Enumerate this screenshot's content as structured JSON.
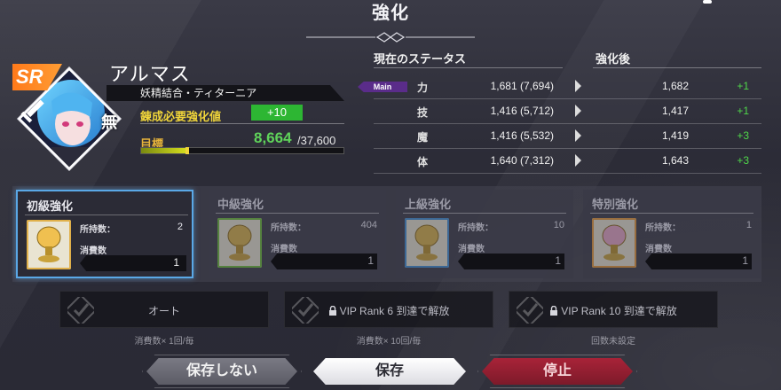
{
  "header": {
    "title": "強化"
  },
  "character": {
    "rarity": "SR",
    "element_glyph": "無",
    "name": "アルマス",
    "type": "妖精結合・ティターニア",
    "required_label": "錬成必要強化値",
    "required_value": "+10",
    "target_label": "目標",
    "target_current": "8,664",
    "target_max": "/37,600",
    "progress_fraction": 0.23
  },
  "status": {
    "current_header": "現在のステータス",
    "after_header": "強化後",
    "main_tag": "Main",
    "rows": [
      {
        "name": "力",
        "current": "1,681 (7,694)",
        "after": "1,682",
        "delta": "+1"
      },
      {
        "name": "技",
        "current": "1,416 (5,712)",
        "after": "1,417",
        "delta": "+1"
      },
      {
        "name": "魔",
        "current": "1,416 (5,532)",
        "after": "1,419",
        "delta": "+3"
      },
      {
        "name": "体",
        "current": "1,640 (7,312)",
        "after": "1,643",
        "delta": "+3"
      }
    ]
  },
  "enhance": {
    "owned_label": "所持数：",
    "consume_label": "消費数",
    "cards": [
      {
        "title": "初級強化",
        "owned": "2",
        "consume": "1",
        "frame": "#e0b04a"
      },
      {
        "title": "中級強化",
        "owned": "404",
        "consume": "1",
        "frame": "#6cbf3a"
      },
      {
        "title": "上級強化",
        "owned": "10",
        "consume": "1",
        "frame": "#3f8fd6"
      },
      {
        "title": "特別強化",
        "owned": "1",
        "consume": "1",
        "frame": "#e89a3a"
      }
    ]
  },
  "options": [
    {
      "label": "オート",
      "sub": "消費数× 1回/毎"
    },
    {
      "label": "VIP Rank 6 到達で解放",
      "sub": "消費数× 10回/毎"
    },
    {
      "label": "VIP Rank 10 到達で解放",
      "sub": "回数未設定"
    }
  ],
  "buttons": {
    "no_save": "保存しない",
    "save": "保存",
    "stop": "停止"
  }
}
